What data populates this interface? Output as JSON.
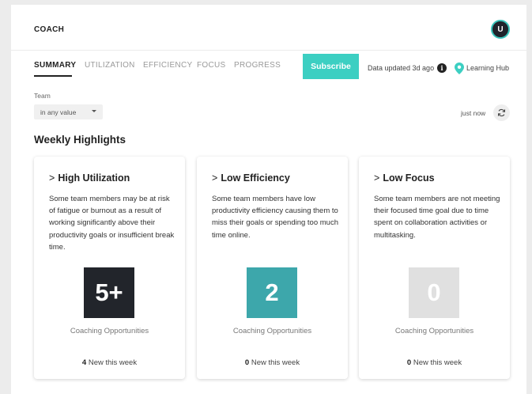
{
  "header": {
    "app_title": "COACH",
    "avatar_initial": "U"
  },
  "tabs": [
    {
      "label": "SUMMARY",
      "active": true
    },
    {
      "label": "UTILIZATION",
      "active": false
    },
    {
      "label": "EFFICIENCY",
      "active": false
    },
    {
      "label": "FOCUS",
      "active": false
    },
    {
      "label": "PROGRESS",
      "active": false
    }
  ],
  "toolbar": {
    "subscribe_label": "Subscribe",
    "data_updated": "Data updated 3d ago",
    "info_icon": "i",
    "learning_hub": "Learning Hub"
  },
  "filters": {
    "team_label": "Team",
    "team_value": "in any value",
    "refresh_time": "just now"
  },
  "section_title": "Weekly Highlights",
  "cards": [
    {
      "chevron": ">",
      "title": "High Utilization",
      "description": "Some team members may be at risk of fatigue or burnout as a result of working significantly above their productivity goals or insufficient break time.",
      "metric": "5+",
      "metric_color": "#22252b",
      "metric_label": "Coaching Opportunities",
      "new_count": "4",
      "new_label": "New this week"
    },
    {
      "chevron": ">",
      "title": "Low Efficiency",
      "description": "Some team members have low productivity efficiency causing them to miss their goals or spending too much time online.",
      "metric": "2",
      "metric_color": "#3da7ab",
      "metric_label": "Coaching Opportunities",
      "new_count": "0",
      "new_label": "New this week"
    },
    {
      "chevron": ">",
      "title": "Low Focus",
      "description": "Some team members are not meeting their focused time goal due to time spent on collaboration activities or multitasking.",
      "metric": "0",
      "metric_color": "#e0e0e0",
      "metric_label": "Coaching Opportunities",
      "new_count": "0",
      "new_label": "New this week"
    }
  ],
  "colors": {
    "accent": "#3ccfc2",
    "avatar_bg": "#1f232b"
  }
}
